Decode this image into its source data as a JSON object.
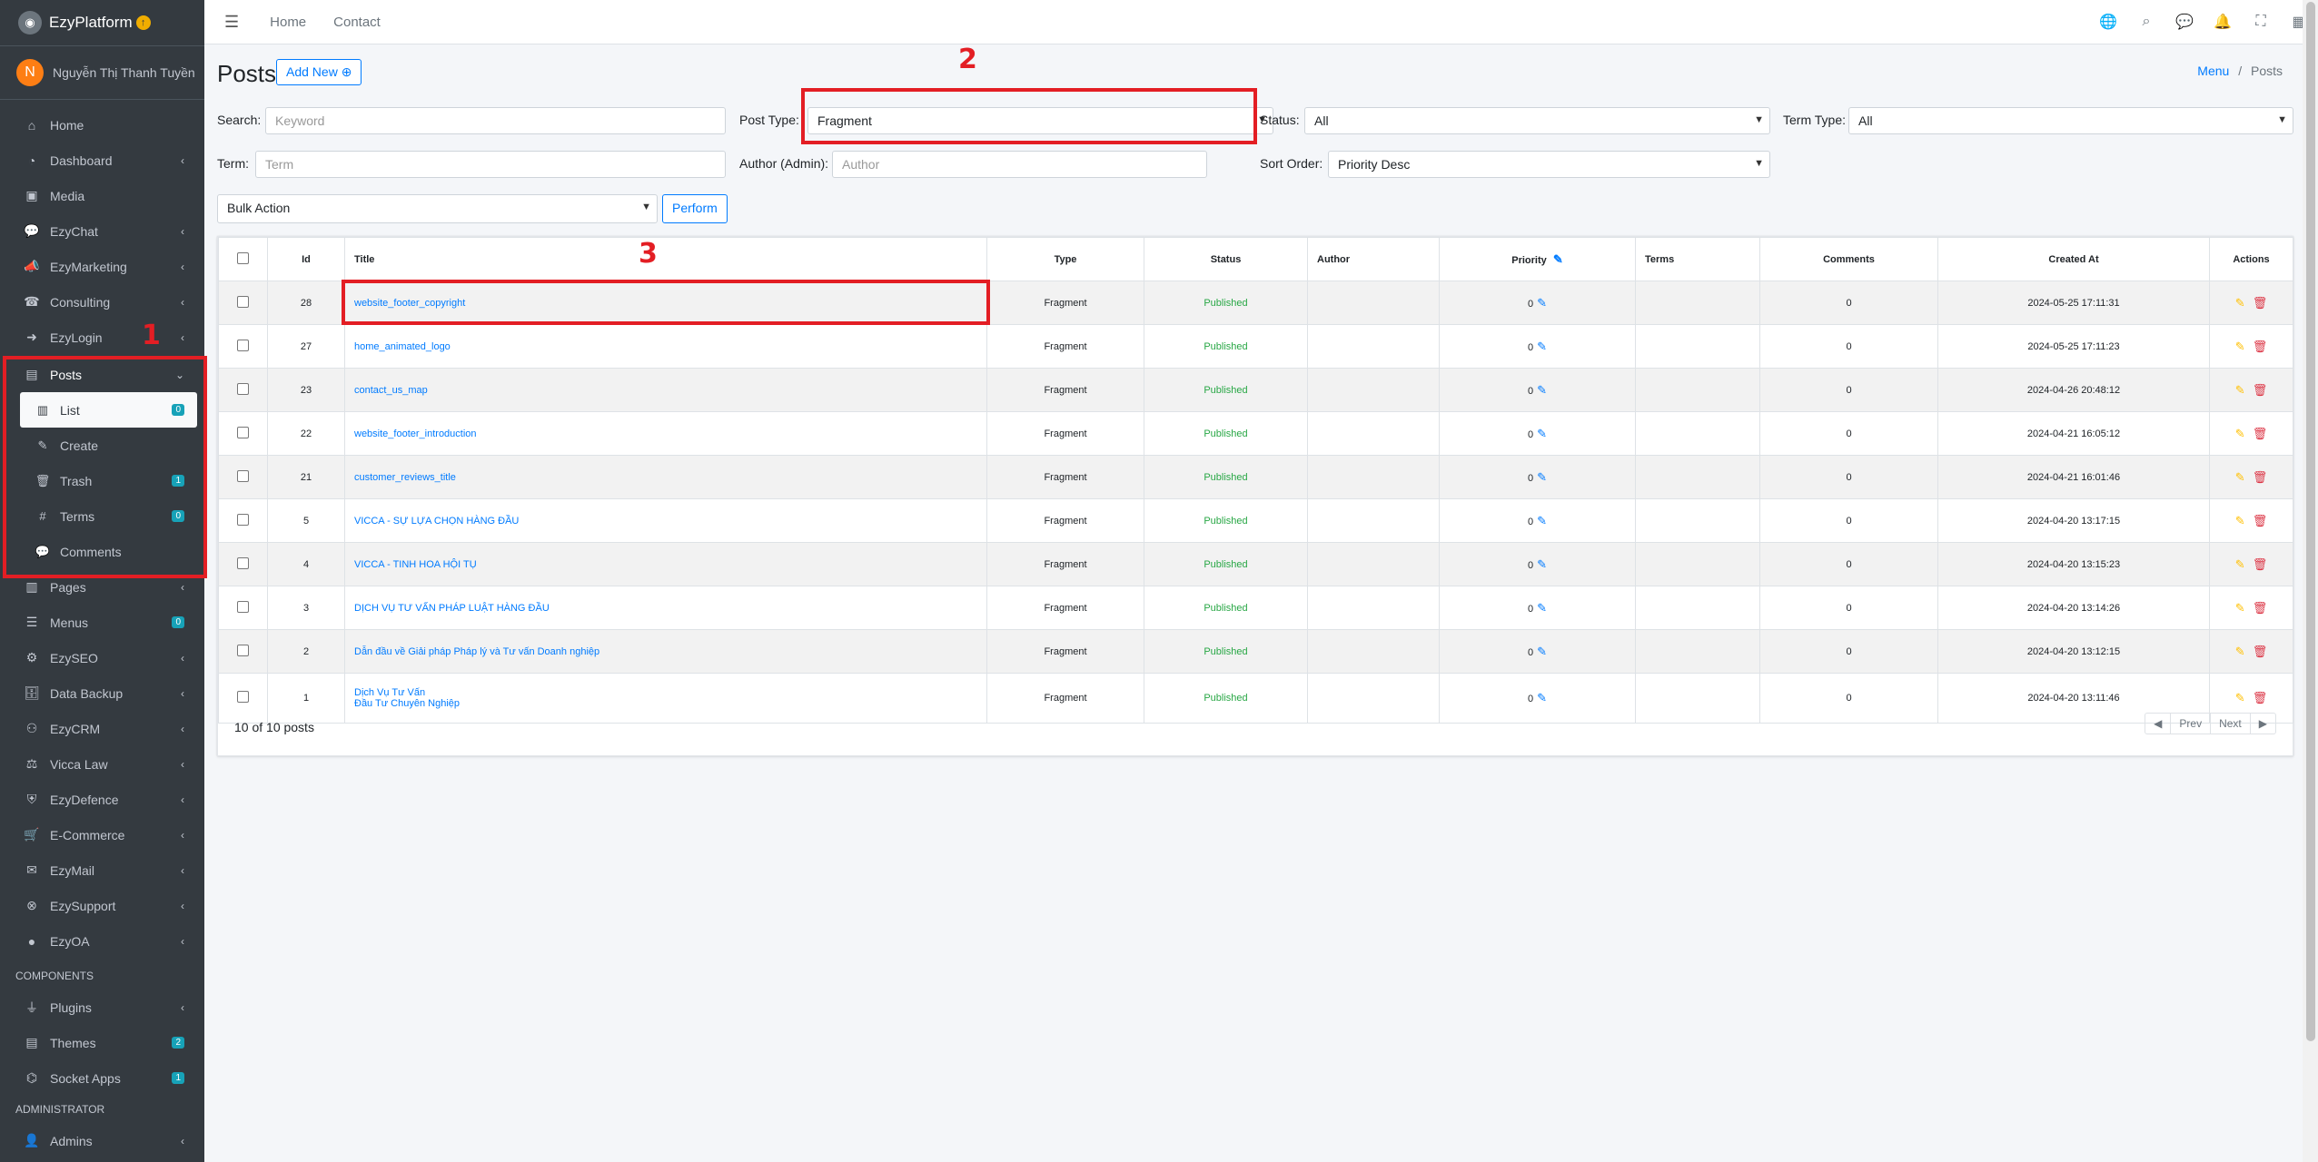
{
  "brand": {
    "name": "EzyPlatform"
  },
  "user": {
    "initial": "N",
    "name": "Nguyễn Thị Thanh Tuyền"
  },
  "sidebar": {
    "items_top": [
      {
        "label": "Home",
        "icon": "home-icon"
      },
      {
        "label": "Dashboard",
        "icon": "dashboard-icon"
      },
      {
        "label": "Media",
        "icon": "image-icon"
      },
      {
        "label": "EzyChat",
        "icon": "chat-icon"
      },
      {
        "label": "EzyMarketing",
        "icon": "megaphone-icon"
      },
      {
        "label": "Consulting",
        "icon": "headset-icon"
      },
      {
        "label": "EzyLogin",
        "icon": "login-icon"
      }
    ],
    "posts": {
      "label": "Posts",
      "list": "List",
      "list_badge": "0",
      "create": "Create",
      "trash": "Trash",
      "trash_badge": "1",
      "terms": "Terms",
      "terms_badge": "0",
      "comments": "Comments"
    },
    "items_mid": [
      {
        "label": "Pages"
      },
      {
        "label": "Menus",
        "badge": "0"
      },
      {
        "label": "EzySEO"
      },
      {
        "label": "Data Backup"
      },
      {
        "label": "EzyCRM"
      },
      {
        "label": "Vicca Law"
      },
      {
        "label": "EzyDefence"
      },
      {
        "label": "E-Commerce"
      },
      {
        "label": "EzyMail"
      },
      {
        "label": "EzySupport"
      },
      {
        "label": "EzyOA"
      }
    ],
    "components_header": "COMPONENTS",
    "components": [
      {
        "label": "Plugins"
      },
      {
        "label": "Themes",
        "badge": "2"
      },
      {
        "label": "Socket Apps",
        "badge": "1"
      }
    ],
    "admin_header": "ADMINISTRATOR",
    "admin": [
      {
        "label": "Admins"
      }
    ]
  },
  "topbar": {
    "home": "Home",
    "contact": "Contact"
  },
  "page": {
    "title": "Posts",
    "add_new": "Add New",
    "breadcrumb_menu": "Menu",
    "breadcrumb_sep": "/",
    "breadcrumb_current": "Posts"
  },
  "filters": {
    "search_label": "Search:",
    "search_placeholder": "Keyword",
    "post_type_label": "Post Type:",
    "post_type_value": "Fragment",
    "status_label": "Status:",
    "status_value": "All",
    "term_type_label": "Term Type:",
    "term_type_value": "All",
    "term_label": "Term:",
    "term_placeholder": "Term",
    "author_label": "Author (Admin):",
    "author_placeholder": "Author",
    "sort_label": "Sort Order:",
    "sort_value": "Priority Desc",
    "bulk_value": "Bulk Action",
    "perform": "Perform"
  },
  "table": {
    "headers": {
      "id": "Id",
      "title": "Title",
      "type": "Type",
      "status": "Status",
      "author": "Author",
      "priority": "Priority",
      "terms": "Terms",
      "comments": "Comments",
      "created": "Created At",
      "actions": "Actions"
    },
    "rows": [
      {
        "id": "28",
        "title": "website_footer_copyright",
        "type": "Fragment",
        "status": "Published",
        "priority": "0",
        "comments": "0",
        "created": "2024-05-25 17:11:31"
      },
      {
        "id": "27",
        "title": "home_animated_logo",
        "type": "Fragment",
        "status": "Published",
        "priority": "0",
        "comments": "0",
        "created": "2024-05-25 17:11:23"
      },
      {
        "id": "23",
        "title": "contact_us_map",
        "type": "Fragment",
        "status": "Published",
        "priority": "0",
        "comments": "0",
        "created": "2024-04-26 20:48:12"
      },
      {
        "id": "22",
        "title": "website_footer_introduction",
        "type": "Fragment",
        "status": "Published",
        "priority": "0",
        "comments": "0",
        "created": "2024-04-21 16:05:12"
      },
      {
        "id": "21",
        "title": "customer_reviews_title",
        "type": "Fragment",
        "status": "Published",
        "priority": "0",
        "comments": "0",
        "created": "2024-04-21 16:01:46"
      },
      {
        "id": "5",
        "title": "VICCA - SỰ LỰA CHỌN HÀNG ĐẦU",
        "type": "Fragment",
        "status": "Published",
        "priority": "0",
        "comments": "0",
        "created": "2024-04-20 13:17:15"
      },
      {
        "id": "4",
        "title": "VICCA - TINH HOA HỘI TỤ",
        "type": "Fragment",
        "status": "Published",
        "priority": "0",
        "comments": "0",
        "created": "2024-04-20 13:15:23"
      },
      {
        "id": "3",
        "title": "DỊCH VỤ TƯ VẤN PHÁP LUẬT HÀNG ĐẦU",
        "type": "Fragment",
        "status": "Published",
        "priority": "0",
        "comments": "0",
        "created": "2024-04-20 13:14:26"
      },
      {
        "id": "2",
        "title": "Dẫn đầu về Giải pháp Pháp lý và Tư vấn Doanh nghiệp",
        "type": "Fragment",
        "status": "Published",
        "priority": "0",
        "comments": "0",
        "created": "2024-04-20 13:12:15"
      },
      {
        "id": "1",
        "title": "Dịch Vụ Tư Vấn",
        "title2": "Đầu Tư Chuyên Nghiệp",
        "type": "Fragment",
        "status": "Published",
        "priority": "0",
        "comments": "0",
        "created": "2024-04-20 13:11:46"
      }
    ],
    "summary": "10 of 10 posts",
    "prev": "Prev",
    "next": "Next"
  },
  "annotations": {
    "one": "1",
    "two": "2",
    "three": "3"
  },
  "colors": {
    "annotation": "#e31e24",
    "sidebar": "#343a40",
    "link": "#007bff",
    "published": "#28a745"
  }
}
